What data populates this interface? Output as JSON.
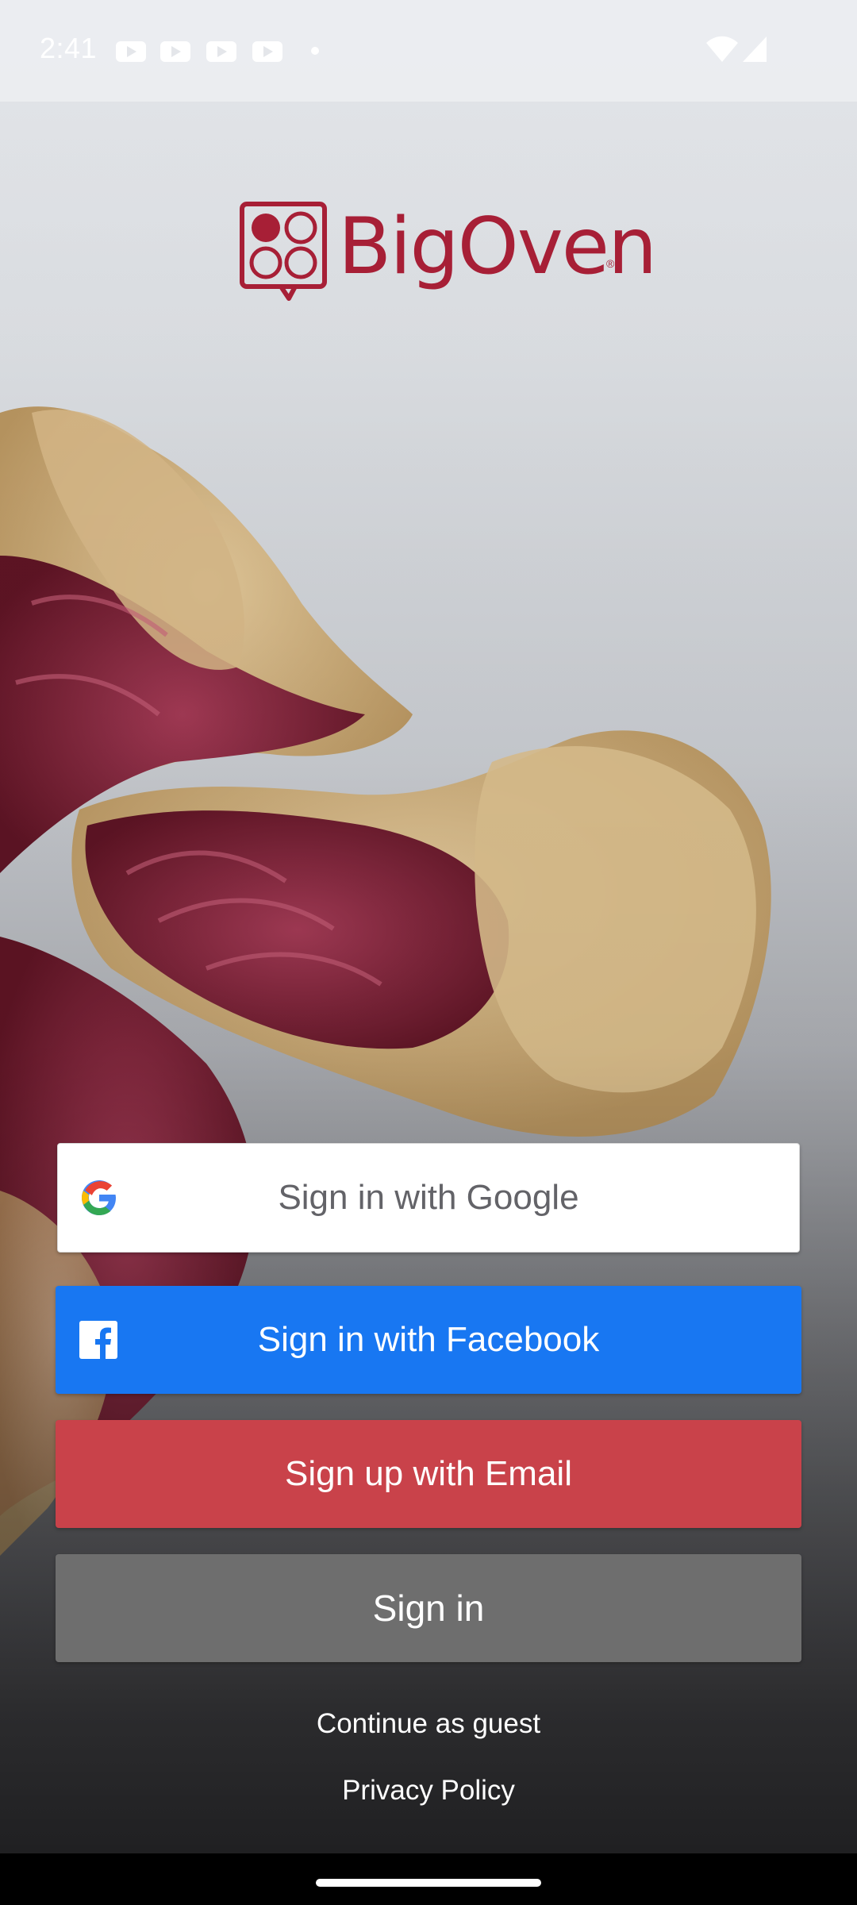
{
  "status_bar": {
    "time": "2:41",
    "icons": [
      "youtube-icon",
      "youtube-icon",
      "youtube-icon",
      "youtube-icon",
      "notification-dot-icon",
      "wifi-icon",
      "signal-icon"
    ]
  },
  "logo": {
    "text": "BigOven",
    "registered": "®",
    "color": "#a71f36"
  },
  "buttons": {
    "google": {
      "label": "Sign in with Google",
      "icon": "google-icon"
    },
    "facebook": {
      "label": "Sign in with Facebook",
      "icon": "facebook-icon",
      "color": "#1877f2"
    },
    "email": {
      "label": "Sign up with Email",
      "color": "#c9424a"
    },
    "signin": {
      "label": "Sign in",
      "color": "#6e6e6e"
    }
  },
  "links": {
    "guest": "Continue as guest",
    "privacy": "Privacy Policy"
  }
}
